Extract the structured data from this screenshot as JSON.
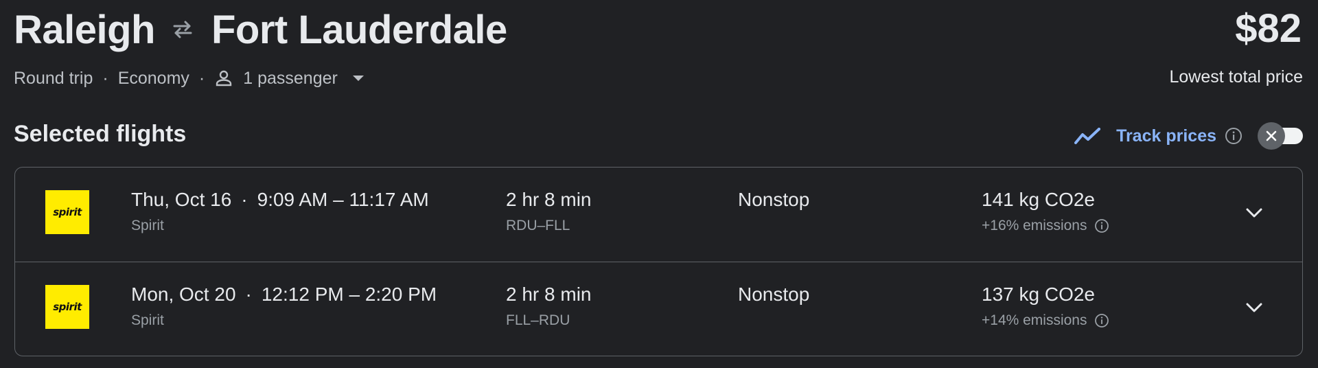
{
  "header": {
    "origin": "Raleigh",
    "destination": "Fort Lauderdale",
    "price": "$82",
    "price_label": "Lowest total price"
  },
  "options": {
    "trip_type": "Round trip",
    "cabin": "Economy",
    "passengers": "1 passenger",
    "separator": "·"
  },
  "section": {
    "title": "Selected flights",
    "track_label": "Track prices",
    "track_enabled": false
  },
  "flights": [
    {
      "date": "Thu, Oct 16",
      "times": "9:09 AM – 11:17 AM",
      "airline": "Spirit",
      "logo_text": "spirit",
      "duration": "2 hr 8 min",
      "route": "RDU–FLL",
      "stops": "Nonstop",
      "co2": "141 kg CO2e",
      "emissions_delta": "+16% emissions"
    },
    {
      "date": "Mon, Oct 20",
      "times": "12:12 PM – 2:20 PM",
      "airline": "Spirit",
      "logo_text": "spirit",
      "duration": "2 hr 8 min",
      "route": "FLL–RDU",
      "stops": "Nonstop",
      "co2": "137 kg CO2e",
      "emissions_delta": "+14% emissions"
    }
  ],
  "colors": {
    "background": "#202124",
    "accent": "#8ab4f8",
    "spirit_yellow": "#ffec00",
    "divider": "#5f6368"
  },
  "icons": {
    "swap": "swap-arrows-icon",
    "person": "person-icon",
    "dropdown": "caret-down-icon",
    "trend": "trend-line-icon",
    "info": "info-icon",
    "close": "close-icon",
    "expand": "chevron-down-icon"
  }
}
